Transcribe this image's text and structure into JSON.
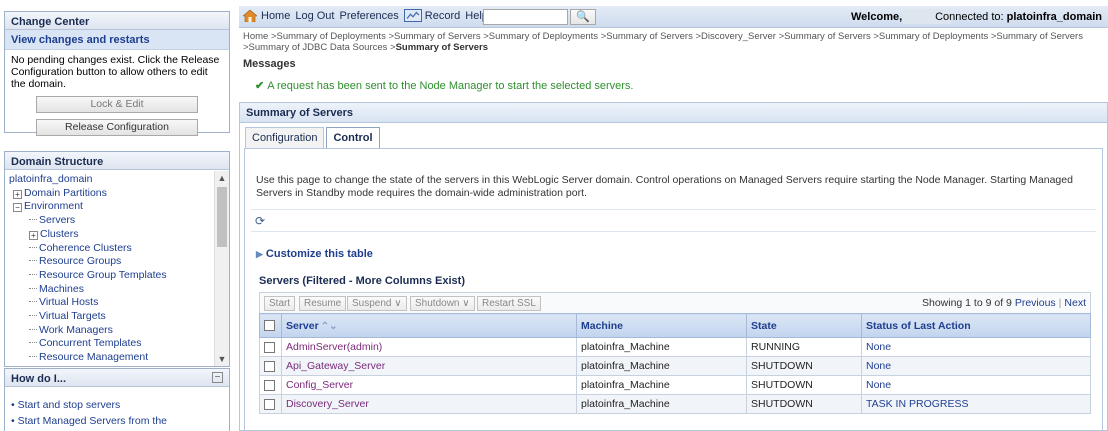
{
  "change_center": {
    "title": "Change Center",
    "link": "View changes and restarts",
    "text": "No pending changes exist. Click the Release Configuration button to allow others to edit the domain.",
    "lock_button": "Lock & Edit",
    "release_button": "Release Configuration"
  },
  "domain_structure": {
    "title": "Domain Structure",
    "items": [
      {
        "label": "platoinfra_domain",
        "level": 0,
        "expander": ""
      },
      {
        "label": "Domain Partitions",
        "level": 1,
        "expander": "+"
      },
      {
        "label": "Environment",
        "level": 1,
        "expander": "-"
      },
      {
        "label": "Servers",
        "level": 2,
        "expander": ""
      },
      {
        "label": "Clusters",
        "level": 2,
        "expander": "+"
      },
      {
        "label": "Coherence Clusters",
        "level": 2,
        "expander": ""
      },
      {
        "label": "Resource Groups",
        "level": 2,
        "expander": ""
      },
      {
        "label": "Resource Group Templates",
        "level": 2,
        "expander": ""
      },
      {
        "label": "Machines",
        "level": 2,
        "expander": ""
      },
      {
        "label": "Virtual Hosts",
        "level": 2,
        "expander": ""
      },
      {
        "label": "Virtual Targets",
        "level": 2,
        "expander": ""
      },
      {
        "label": "Work Managers",
        "level": 2,
        "expander": ""
      },
      {
        "label": "Concurrent Templates",
        "level": 2,
        "expander": ""
      },
      {
        "label": "Resource Management",
        "level": 2,
        "expander": ""
      }
    ]
  },
  "how_do_i": {
    "title": "How do I...",
    "items": [
      "Start and stop servers",
      "Start Managed Servers from the"
    ]
  },
  "top_bar": {
    "home": "Home",
    "logout": "Log Out",
    "preferences": "Preferences",
    "record": "Record",
    "help": "Help",
    "search_value": "",
    "welcome": "Welcome,",
    "connected_prefix": "Connected to:",
    "connected_domain": "platoinfra_domain"
  },
  "breadcrumb": {
    "trail": "Home >Summary of Deployments >Summary of Servers >Summary of Deployments >Summary of Servers >Discovery_Server >Summary of Servers >Summary of Deployments >Summary of Servers >Summary of JDBC Data Sources >",
    "current": "Summary of Servers"
  },
  "messages": {
    "label": "Messages",
    "text": "A request has been sent to the Node Manager to start the selected servers."
  },
  "summary": {
    "title": "Summary of Servers",
    "tabs": [
      "Configuration",
      "Control"
    ],
    "active_tab": "Control",
    "description": "Use this page to change the state of the servers in this WebLogic Server domain. Control operations on Managed Servers require starting the Node Manager. Starting Managed Servers in Standby mode requires the domain-wide administration port.",
    "customize": "Customize this table",
    "table_title": "Servers (Filtered - More Columns Exist)",
    "toolbar": {
      "start": "Start",
      "resume": "Resume",
      "suspend": "Suspend ∨",
      "shutdown": "Shutdown ∨",
      "restart_ssl": "Restart SSL"
    },
    "paging": {
      "showing": "Showing 1 to 9 of 9",
      "previous": "Previous",
      "next": "Next"
    },
    "columns": [
      "Server",
      "Machine",
      "State",
      "Status of Last Action"
    ],
    "rows": [
      {
        "server": "AdminServer(admin)",
        "machine": "platoinfra_Machine",
        "state": "RUNNING",
        "status": "None"
      },
      {
        "server": "Api_Gateway_Server",
        "machine": "platoinfra_Machine",
        "state": "SHUTDOWN",
        "status": "None"
      },
      {
        "server": "Config_Server",
        "machine": "platoinfra_Machine",
        "state": "SHUTDOWN",
        "status": "None"
      },
      {
        "server": "Discovery_Server",
        "machine": "platoinfra_Machine",
        "state": "SHUTDOWN",
        "status": "TASK IN PROGRESS"
      }
    ]
  }
}
